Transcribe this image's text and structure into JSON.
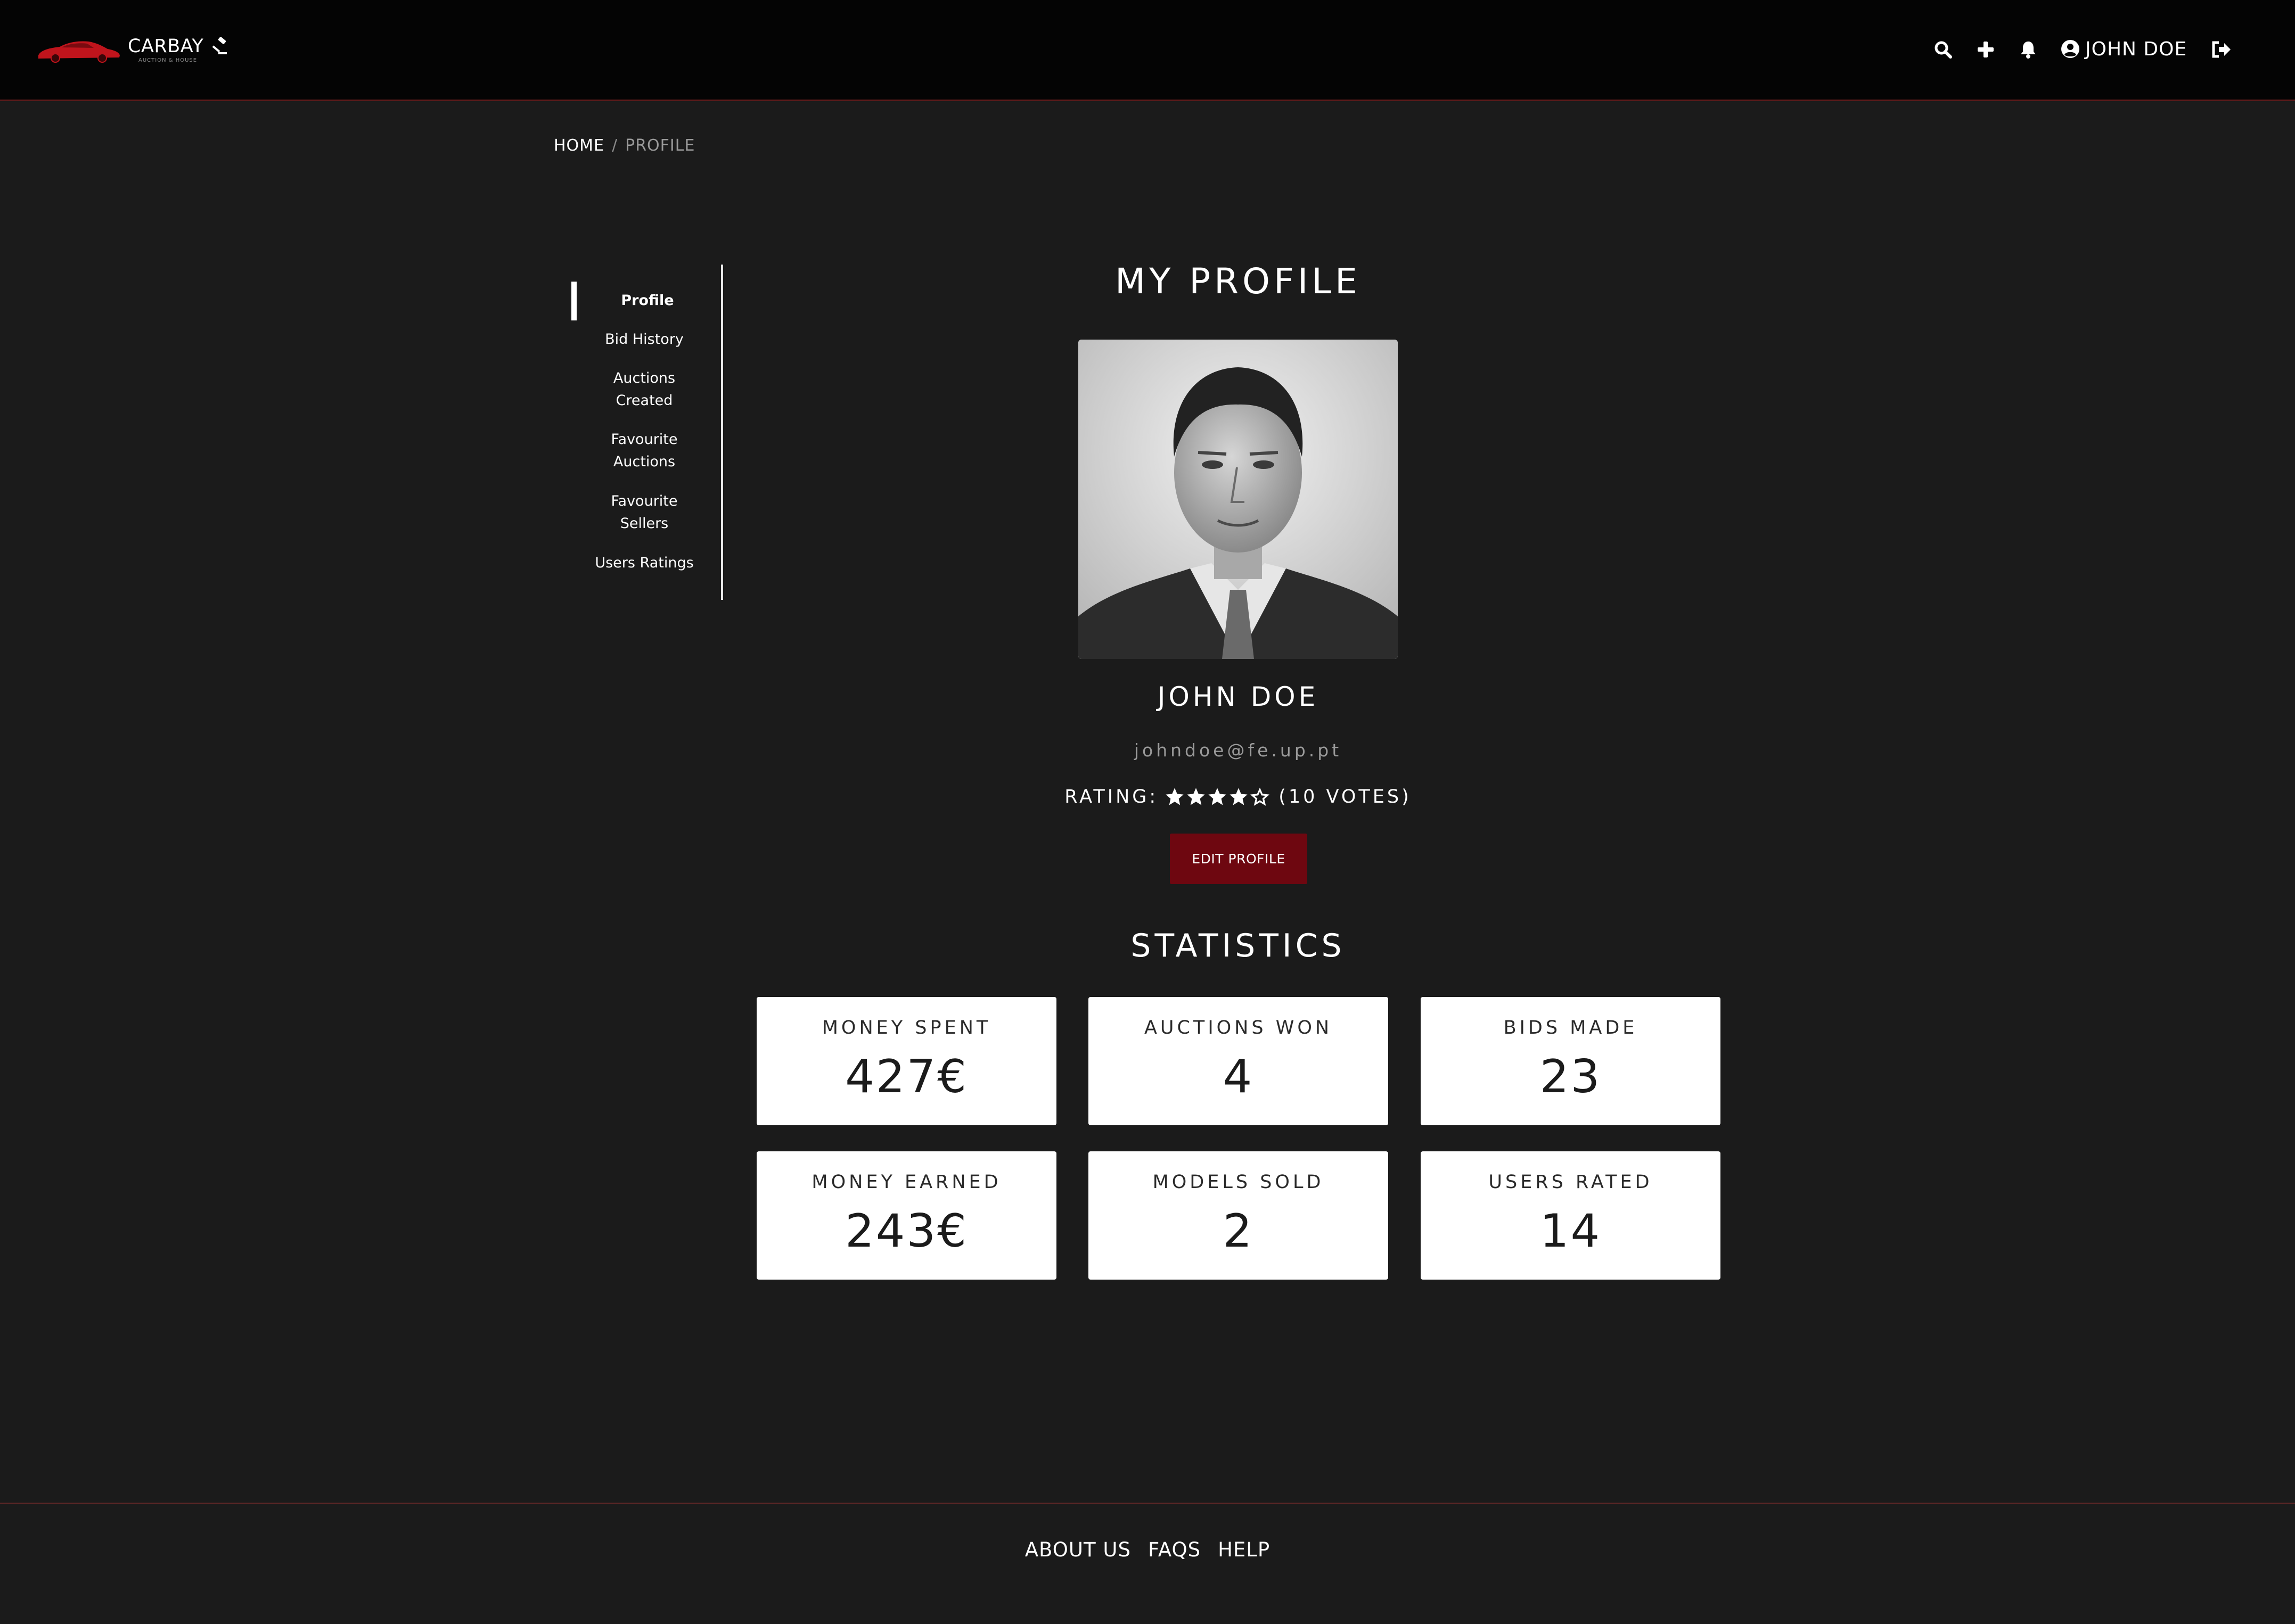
{
  "header": {
    "brand": "CARBAY",
    "brand_subtitle": "AUCTION & HOUSE",
    "user_name": "JOHN DOE",
    "icons": [
      "search-icon",
      "plus-icon",
      "bell-icon",
      "user-circle-icon",
      "logout-icon"
    ]
  },
  "breadcrumb": {
    "home": "HOME",
    "separator": "/",
    "current": "PROFILE"
  },
  "sidebar": {
    "items": [
      {
        "label": "Profile",
        "active": true
      },
      {
        "label": "Bid History"
      },
      {
        "label": "Auctions Created"
      },
      {
        "label": "Favourite Auctions"
      },
      {
        "label": "Favourite Sellers"
      },
      {
        "label": "Users Ratings"
      }
    ]
  },
  "profile": {
    "title": "MY PROFILE",
    "name": "JOHN DOE",
    "email": "johndoe@fe.up.pt",
    "rating_label": "RATING:",
    "rating_stars": 4,
    "rating_max": 5,
    "votes": "(10 VOTES)",
    "edit_button": "EDIT PROFILE"
  },
  "statistics": {
    "title": "STATISTICS",
    "cards": [
      {
        "label": "MONEY SPENT",
        "value": "427€"
      },
      {
        "label": "AUCTIONS WON",
        "value": "4"
      },
      {
        "label": "BIDS MADE",
        "value": "23"
      },
      {
        "label": "MONEY EARNED",
        "value": "243€"
      },
      {
        "label": "MODELS SOLD",
        "value": "2"
      },
      {
        "label": "USERS RATED",
        "value": "14"
      }
    ]
  },
  "footer": {
    "links": [
      "ABOUT US",
      "FAQS",
      "HELP"
    ]
  },
  "colors": {
    "background": "#1b1b1b",
    "header": "#040404",
    "accent": "#6e0710",
    "brand_red": "#c0141c"
  }
}
